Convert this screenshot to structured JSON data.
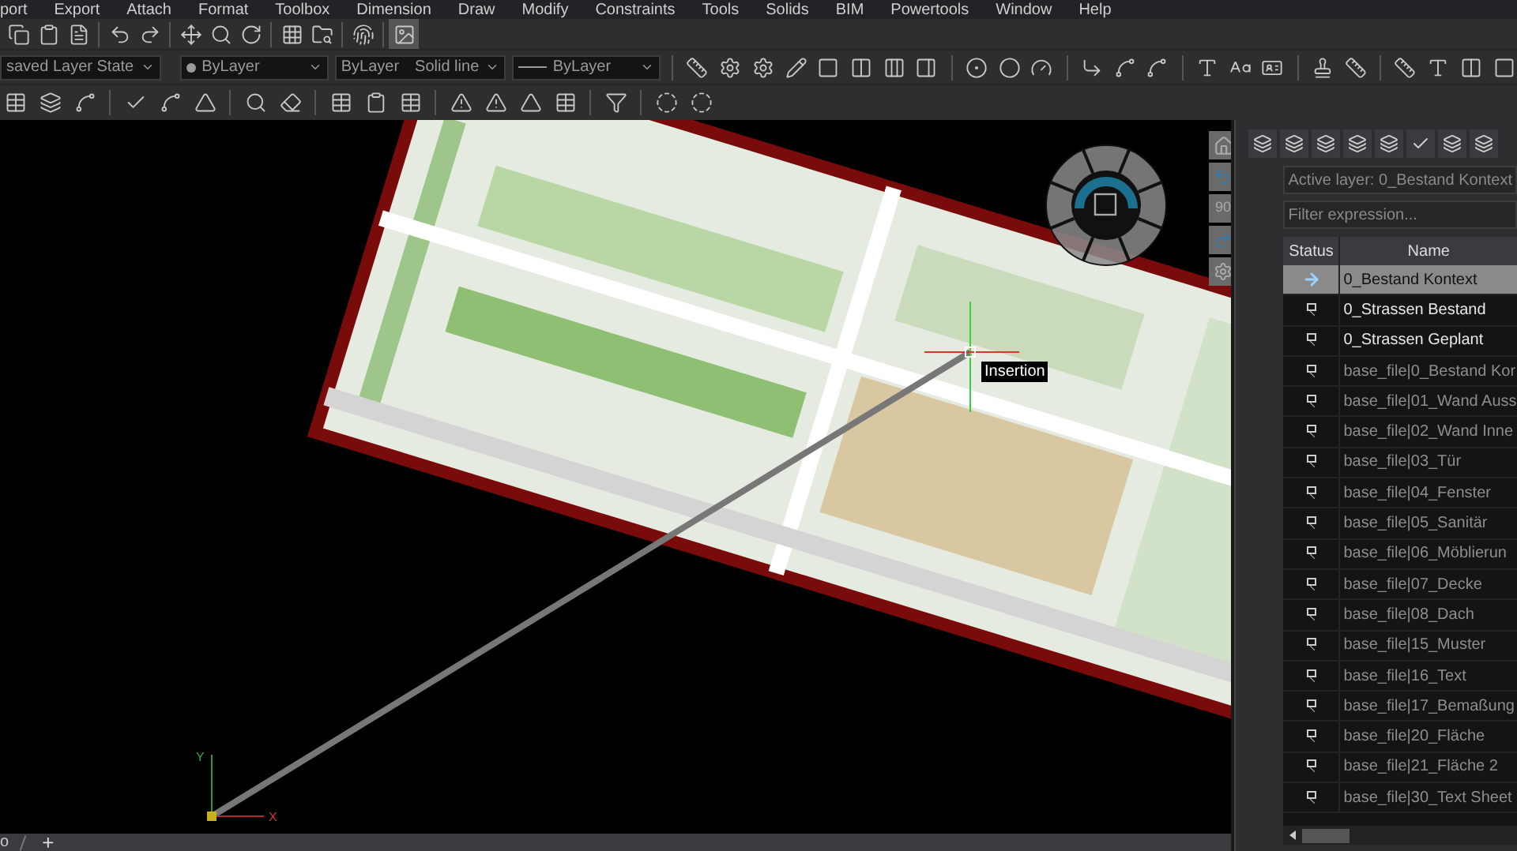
{
  "menu_bar": [
    "port",
    "Export",
    "Attach",
    "Format",
    "Toolbox",
    "Dimension",
    "Draw",
    "Modify",
    "Constraints",
    "Tools",
    "Solids",
    "BIM",
    "Powertools",
    "Window",
    "Help"
  ],
  "properties_toolbar": {
    "layer_state": "saved Layer State",
    "color_setting": "ByLayer",
    "linetype": "ByLayer",
    "linetype_name": "Solid line",
    "lineweight": "ByLayer"
  },
  "viewport": {
    "view_controls_angle": "90",
    "tooltip": "Insertion",
    "axis_y": "Y",
    "axis_x": "X"
  },
  "layer_panel": {
    "active_layer": "Active layer: 0_Bestand Kontext",
    "filter_placeholder": "Filter expression...",
    "columns": [
      "Status",
      "Name"
    ],
    "rows": [
      {
        "name": "0_Bestand Kontext",
        "selected": true,
        "xref": false
      },
      {
        "name": "0_Strassen Bestand",
        "selected": false,
        "xref": false
      },
      {
        "name": "0_Strassen Geplant",
        "selected": false,
        "xref": false
      },
      {
        "name": "base_file|0_Bestand Kor",
        "selected": false,
        "xref": true
      },
      {
        "name": "base_file|01_Wand Auss",
        "selected": false,
        "xref": true
      },
      {
        "name": "base_file|02_Wand Inne",
        "selected": false,
        "xref": true
      },
      {
        "name": "base_file|03_Tür",
        "selected": false,
        "xref": true
      },
      {
        "name": "base_file|04_Fenster",
        "selected": false,
        "xref": true
      },
      {
        "name": "base_file|05_Sanitär",
        "selected": false,
        "xref": true
      },
      {
        "name": "base_file|06_Möblierun",
        "selected": false,
        "xref": true
      },
      {
        "name": "base_file|07_Decke",
        "selected": false,
        "xref": true
      },
      {
        "name": "base_file|08_Dach",
        "selected": false,
        "xref": true
      },
      {
        "name": "base_file|15_Muster",
        "selected": false,
        "xref": true
      },
      {
        "name": "base_file|16_Text",
        "selected": false,
        "xref": true
      },
      {
        "name": "base_file|17_Bemaßung",
        "selected": false,
        "xref": true
      },
      {
        "name": "base_file|20_Fläche",
        "selected": false,
        "xref": true
      },
      {
        "name": "base_file|21_Fläche 2",
        "selected": false,
        "xref": true
      },
      {
        "name": "base_file|30_Text Sheet",
        "selected": false,
        "xref": true
      }
    ]
  },
  "layout_tabs": {
    "tab_fragment": "o",
    "add": "+"
  }
}
